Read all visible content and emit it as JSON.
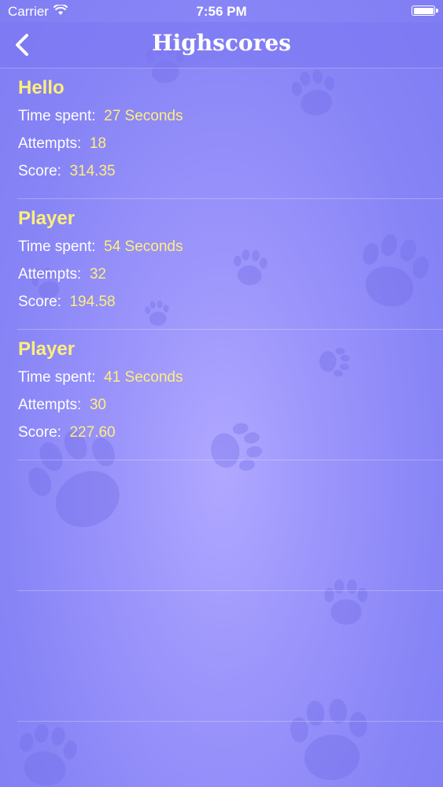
{
  "status_bar": {
    "carrier": "Carrier",
    "time": "7:56 PM"
  },
  "nav": {
    "title": "Highscores",
    "back_icon": "chevron-left-icon"
  },
  "labels": {
    "time_spent": "Time spent:",
    "attempts": "Attempts:",
    "score": "Score:"
  },
  "scores": [
    {
      "name": "Hello",
      "time": "27 Seconds",
      "attempts": "18",
      "score": "314.35"
    },
    {
      "name": "Player",
      "time": "54 Seconds",
      "attempts": "32",
      "score": "194.58"
    },
    {
      "name": "Player",
      "time": "41 Seconds",
      "attempts": "30",
      "score": "227.60"
    }
  ],
  "empty_rows": 2,
  "colors": {
    "accent_yellow": "#ffef7a",
    "background": "#9a94fb",
    "text": "#ffffff"
  }
}
